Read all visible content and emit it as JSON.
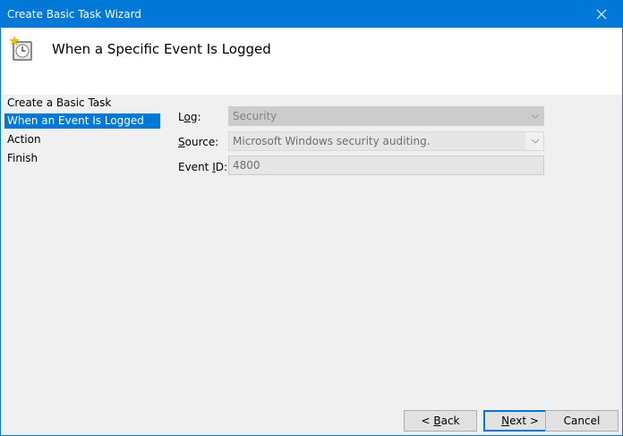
{
  "window": {
    "title": "Create Basic Task Wizard"
  },
  "header": {
    "heading": "When a Specific Event Is Logged",
    "icon": "task-clock-icon"
  },
  "sidebar": {
    "items": [
      {
        "label": "Create a Basic Task",
        "selected": false
      },
      {
        "label": "When an Event Is Logged",
        "selected": true
      },
      {
        "label": "Action",
        "selected": false
      },
      {
        "label": "Finish",
        "selected": false
      }
    ]
  },
  "form": {
    "log": {
      "label_pre": "L",
      "label_u": "o",
      "label_post": "g:",
      "value": "Security"
    },
    "source": {
      "label_pre": "",
      "label_u": "S",
      "label_post": "ource:",
      "value": "Microsoft Windows security auditing."
    },
    "event_id": {
      "label_pre": "Event ",
      "label_u": "I",
      "label_post": "D:",
      "value": "4800"
    }
  },
  "buttons": {
    "back": {
      "prefix": "< ",
      "u": "B",
      "rest": "ack"
    },
    "next": {
      "prefix": "",
      "u": "N",
      "rest": "ext >"
    },
    "cancel": {
      "label": "Cancel"
    }
  },
  "colors": {
    "accent": "#0078d7"
  }
}
